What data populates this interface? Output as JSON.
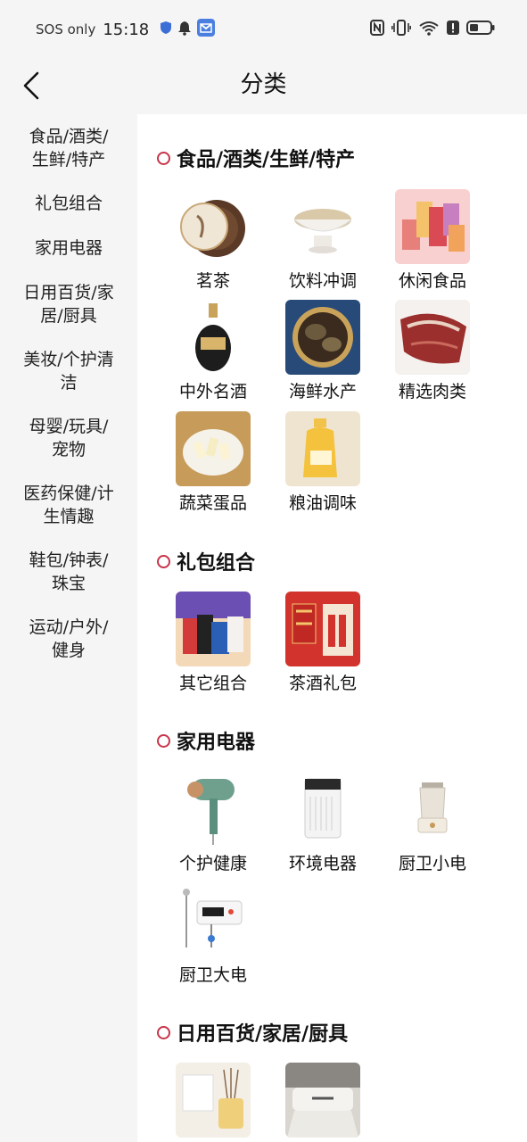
{
  "status_bar": {
    "carrier": "SOS only",
    "time": "15:18"
  },
  "header": {
    "title": "分类"
  },
  "sidebar": {
    "items": [
      {
        "lines": [
          "食品/酒类/",
          "生鲜/特产"
        ]
      },
      {
        "lines": [
          "礼包组合"
        ]
      },
      {
        "lines": [
          "家用电器"
        ]
      },
      {
        "lines": [
          "日用百货/家",
          "居/厨具"
        ]
      },
      {
        "lines": [
          "美妆/个护清",
          "洁"
        ]
      },
      {
        "lines": [
          "母婴/玩具/",
          "宠物"
        ]
      },
      {
        "lines": [
          "医药保健/计",
          "生情趣"
        ]
      },
      {
        "lines": [
          "鞋包/钟表/",
          "珠宝"
        ]
      },
      {
        "lines": [
          "运动/户外/",
          "健身"
        ]
      }
    ]
  },
  "sections": [
    {
      "title": "食品/酒类/生鲜/特产",
      "items": [
        {
          "label": "茗茶",
          "icon": "pu-erh-tea-cake"
        },
        {
          "label": "饮料冲调",
          "icon": "oat-bowl"
        },
        {
          "label": "休闲食品",
          "icon": "snack-bags"
        },
        {
          "label": "中外名酒",
          "icon": "liquor-bottle"
        },
        {
          "label": "海鲜水产",
          "icon": "abalone-soup"
        },
        {
          "label": "精选肉类",
          "icon": "cured-ham"
        },
        {
          "label": "蔬菜蛋品",
          "icon": "vegetable-plate"
        },
        {
          "label": "粮油调味",
          "icon": "oil-bottle"
        }
      ]
    },
    {
      "title": "礼包组合",
      "items": [
        {
          "label": "其它组合",
          "icon": "gift-box-set"
        },
        {
          "label": "茶酒礼包",
          "icon": "tea-wine-gift"
        }
      ]
    },
    {
      "title": "家用电器",
      "items": [
        {
          "label": "个护健康",
          "icon": "garment-steamer"
        },
        {
          "label": "环境电器",
          "icon": "air-purifier"
        },
        {
          "label": "厨卫小电",
          "icon": "blender"
        },
        {
          "label": "厨卫大电",
          "icon": "water-heater"
        }
      ]
    },
    {
      "title": "日用百货/家居/厨具",
      "items": [
        {
          "label": "",
          "icon": "reed-diffuser"
        },
        {
          "label": "",
          "icon": "bedding"
        }
      ]
    }
  ],
  "colors": {
    "accent": "#c8344a",
    "sidebar_bg": "#f5f5f5"
  }
}
